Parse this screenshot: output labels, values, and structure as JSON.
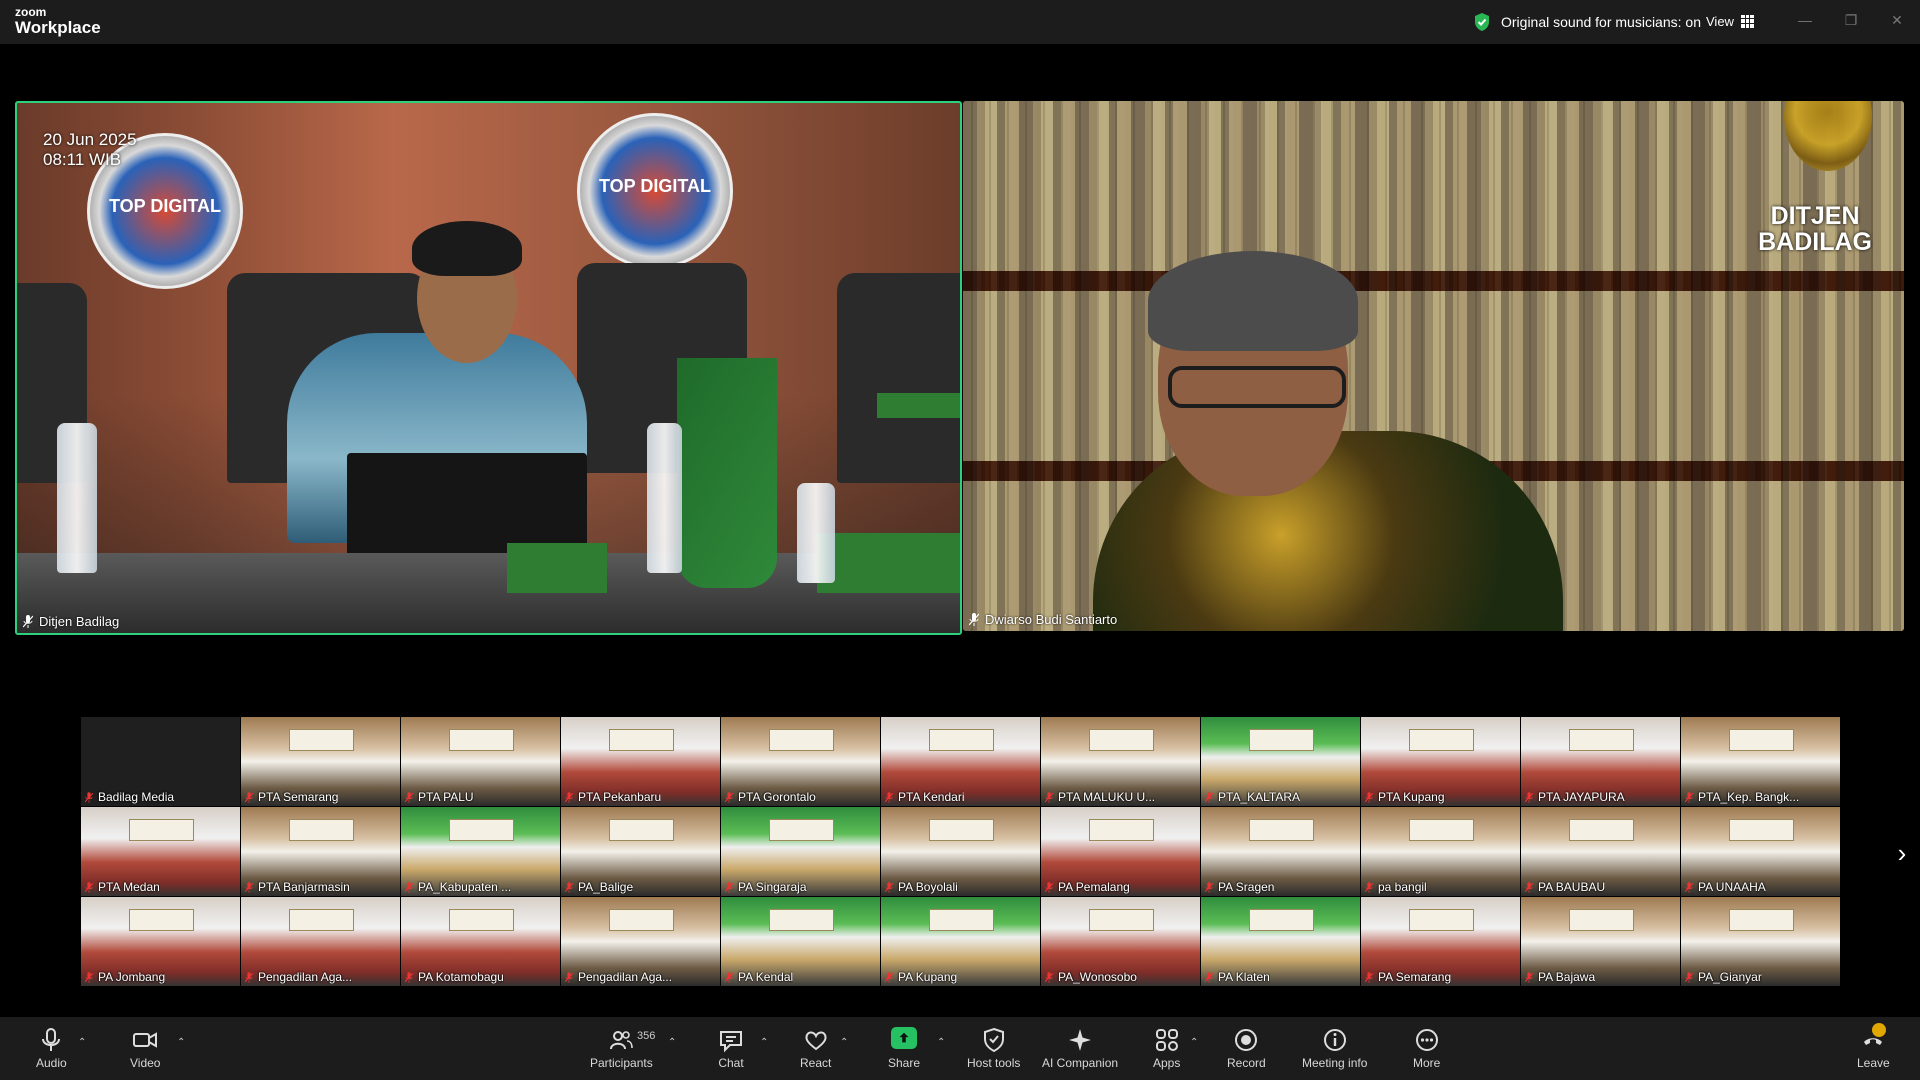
{
  "app": {
    "brand_small": "zoom",
    "brand_large": "Workplace"
  },
  "titlebar": {
    "sound_status": "Original sound for musicians: on",
    "view_label": "View",
    "window_controls": [
      "minimize",
      "maximize",
      "close"
    ]
  },
  "main_video": {
    "left": {
      "name": "Ditjen Badilag",
      "date": "20 Jun 2025",
      "time": "08:11 WIB",
      "badge1": "TOP DIGITAL",
      "badge2": "TOP DIGITAL"
    },
    "right": {
      "name": "Dwiarso Budi Santiarto",
      "overlay_line1": "DITJEN",
      "overlay_line2": "BADILAG"
    }
  },
  "gallery": {
    "participants": [
      "Badilag Media",
      "PTA Semarang",
      "PTA PALU",
      "PTA Pekanbaru",
      "PTA Gorontalo",
      "PTA Kendari",
      "PTA MALUKU U...",
      "PTA_KALTARA",
      "PTA Kupang",
      "PTA JAYAPURA",
      "PTA_Kep. Bangk...",
      "PTA Medan",
      "PTA Banjarmasin",
      "PA_Kabupaten ...",
      "PA_Balige",
      "PA Singaraja",
      "PA Boyolali",
      "PA Pemalang",
      "PA Sragen",
      "pa bangil",
      "PA BAUBAU",
      "PA UNAAHA",
      "PA Jombang",
      "Pengadilan Aga...",
      "PA Kotamobagu",
      "Pengadilan Aga...",
      "PA Kendal",
      "PA Kupang",
      "PA_Wonosobo",
      "PA Klaten",
      "PA Semarang",
      "PA Bajawa",
      "PA_Gianyar"
    ]
  },
  "toolbar": {
    "audio": "Audio",
    "video": "Video",
    "participants": "Participants",
    "participants_count": "356",
    "chat": "Chat",
    "react": "React",
    "share": "Share",
    "host_tools": "Host tools",
    "ai_companion": "AI Companion",
    "apps": "Apps",
    "record": "Record",
    "meeting_info": "Meeting info",
    "more": "More",
    "leave": "Leave"
  },
  "colors": {
    "active_speaker": "#2ed17b",
    "share_green": "#25c163",
    "toolbar_bg": "#1c1c1c"
  }
}
